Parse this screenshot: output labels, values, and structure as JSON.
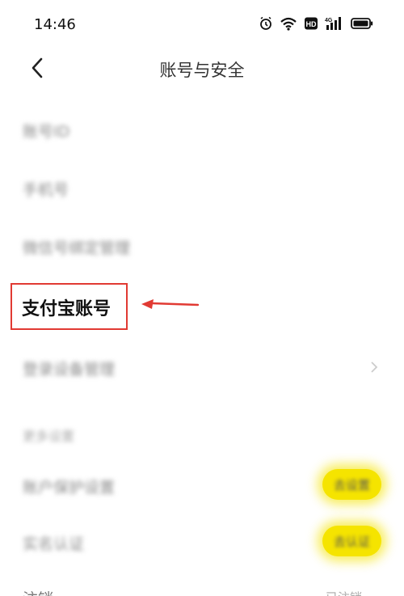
{
  "status_bar": {
    "time": "14:46",
    "icons": [
      "alarm-icon",
      "wifi-icon",
      "hd-icon",
      "4g-signal-icon",
      "battery-icon"
    ]
  },
  "nav": {
    "title": "账号与安全",
    "back_icon": "chevron-left-icon"
  },
  "rows": [
    {
      "label": "账号ID",
      "value": ""
    },
    {
      "label": "手机号",
      "value": ""
    },
    {
      "label": "微信号绑定管理",
      "value": ""
    },
    {
      "label": "支付宝账号",
      "value": ""
    },
    {
      "label": "登录设备管理",
      "value": ""
    }
  ],
  "section_header": "更多设置",
  "badge_rows": [
    {
      "label": "账户保护设置",
      "badge": "去设置"
    },
    {
      "label": "实名认证",
      "badge": "去认证"
    }
  ],
  "bottom_row": {
    "label": "注销",
    "value": "已注销"
  },
  "annotation": {
    "color": "#e13a33"
  },
  "colors": {
    "badge": "#f5e400",
    "annotation": "#e13a33"
  }
}
